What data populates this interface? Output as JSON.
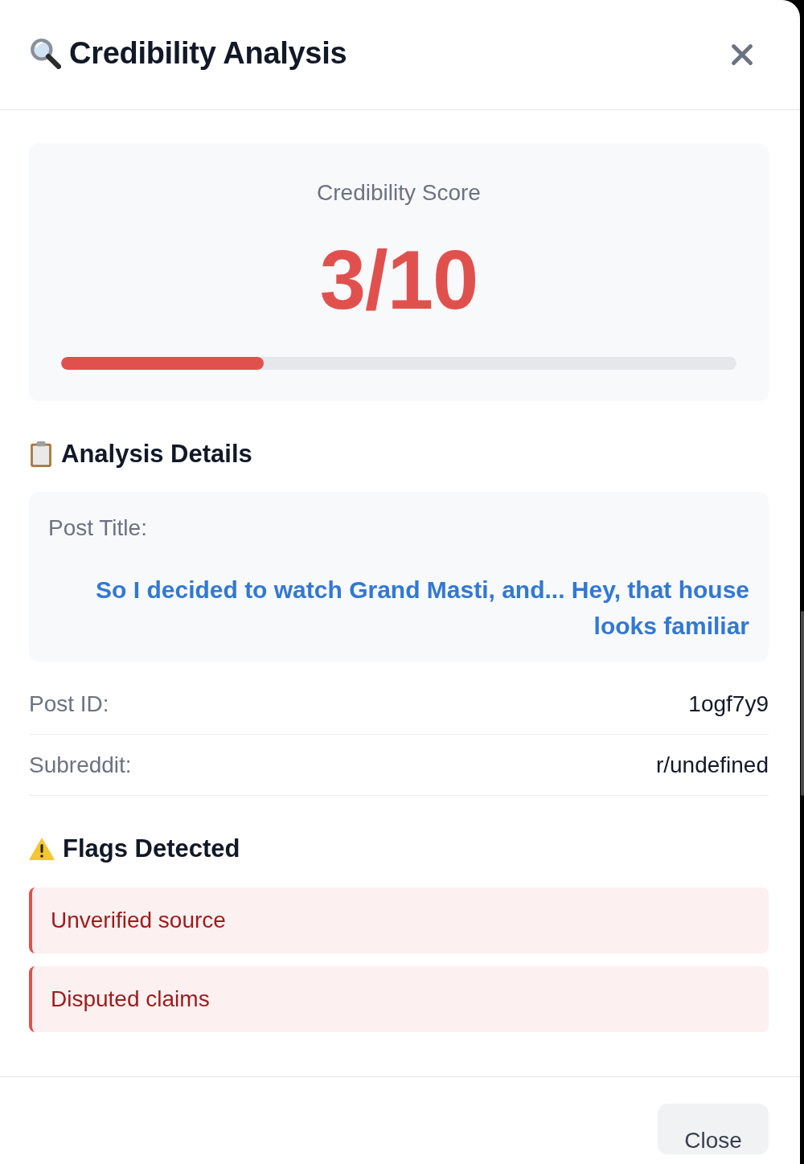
{
  "dialog": {
    "title": "Credibility Analysis"
  },
  "score": {
    "label": "Credibility Score",
    "value": "3/10",
    "level": 0.3
  },
  "details": {
    "heading": "Analysis Details",
    "post_title_label": "Post Title:",
    "post_title": "So I decided to watch Grand Masti, and... Hey, that house looks familiar",
    "fields": [
      {
        "label": "Post ID:",
        "value": "1ogf7y9"
      },
      {
        "label": "Subreddit:",
        "value": "r/undefined"
      }
    ]
  },
  "flags": {
    "heading": "Flags Detected",
    "items": [
      "Unverified source",
      "Disputed claims"
    ]
  },
  "footer": {
    "buttons": [
      "Close"
    ]
  }
}
